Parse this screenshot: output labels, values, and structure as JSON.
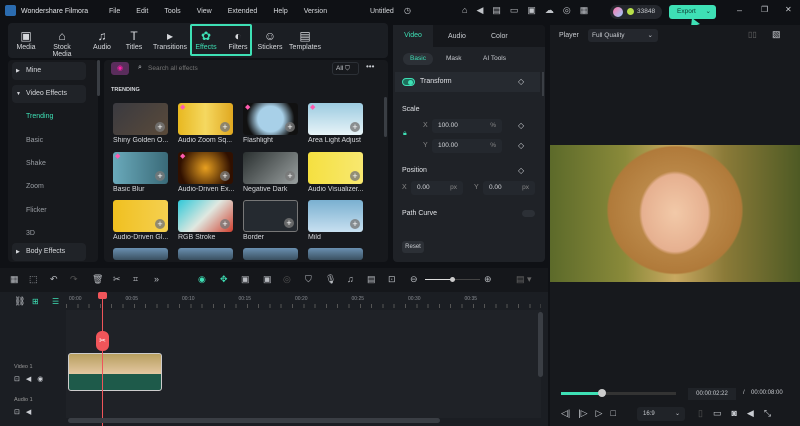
{
  "titlebar": {
    "app": "Wondershare Filmora",
    "menu": [
      "File",
      "Edit",
      "Tools",
      "View",
      "Extended",
      "Help",
      "Version"
    ],
    "project": "Untitled",
    "credits": "33848",
    "export": "Export"
  },
  "toolbar": [
    {
      "label": "Media",
      "icon": "media-icon"
    },
    {
      "label": "Stock Media",
      "icon": "stock-media-icon"
    },
    {
      "label": "Audio",
      "icon": "audio-icon"
    },
    {
      "label": "Titles",
      "icon": "titles-icon"
    },
    {
      "label": "Transitions",
      "icon": "transitions-icon"
    },
    {
      "label": "Effects",
      "icon": "effects-icon"
    },
    {
      "label": "Filters",
      "icon": "filters-icon"
    },
    {
      "label": "Stickers",
      "icon": "stickers-icon"
    },
    {
      "label": "Templates",
      "icon": "templates-icon"
    }
  ],
  "sidebar": {
    "items": [
      "Mine",
      "Video Effects",
      "Trending",
      "Basic",
      "Shake",
      "Zoom",
      "Flicker",
      "3D",
      "Body Effects"
    ]
  },
  "effects": {
    "search_placeholder": "Search all effects",
    "filter": "All",
    "section": "TRENDING",
    "items": [
      "Shiny Golden O...",
      "Audio Zoom Sq...",
      "Flashlight",
      "Area Light Adjust",
      "Basic Blur",
      "Audio-Driven Ex...",
      "Negative Dark",
      "Audio Visualizer...",
      "Audio-Driven Gl...",
      "RGB Stroke",
      "Border",
      "Mild"
    ]
  },
  "properties": {
    "tabs": [
      "Video",
      "Audio",
      "Color"
    ],
    "subtabs": [
      "Basic",
      "Mask",
      "AI Tools"
    ],
    "transform": "Transform",
    "scale": "Scale",
    "x_label": "X",
    "y_label": "Y",
    "scale_x": "100.00",
    "scale_y": "100.00",
    "percent": "%",
    "position": "Position",
    "pos_x": "0.00",
    "pos_y": "0.00",
    "px": "px",
    "path_curve": "Path Curve",
    "reset": "Reset"
  },
  "player": {
    "label": "Player",
    "quality": "Full Quality",
    "current": "00:00:02:22",
    "separator": "/",
    "total": "00:00:08:00",
    "ratio": "16:9",
    "progress": 0.36
  },
  "timeline": {
    "ticks": [
      "00:00",
      "00:05",
      "00:10",
      "00:15",
      "00:20",
      "00:25",
      "00:30",
      "00:35"
    ],
    "tracks": [
      "Video 1",
      "Audio 1"
    ]
  },
  "colors": {
    "accent": "#3ee0b5",
    "playhead": "#f0555a"
  }
}
